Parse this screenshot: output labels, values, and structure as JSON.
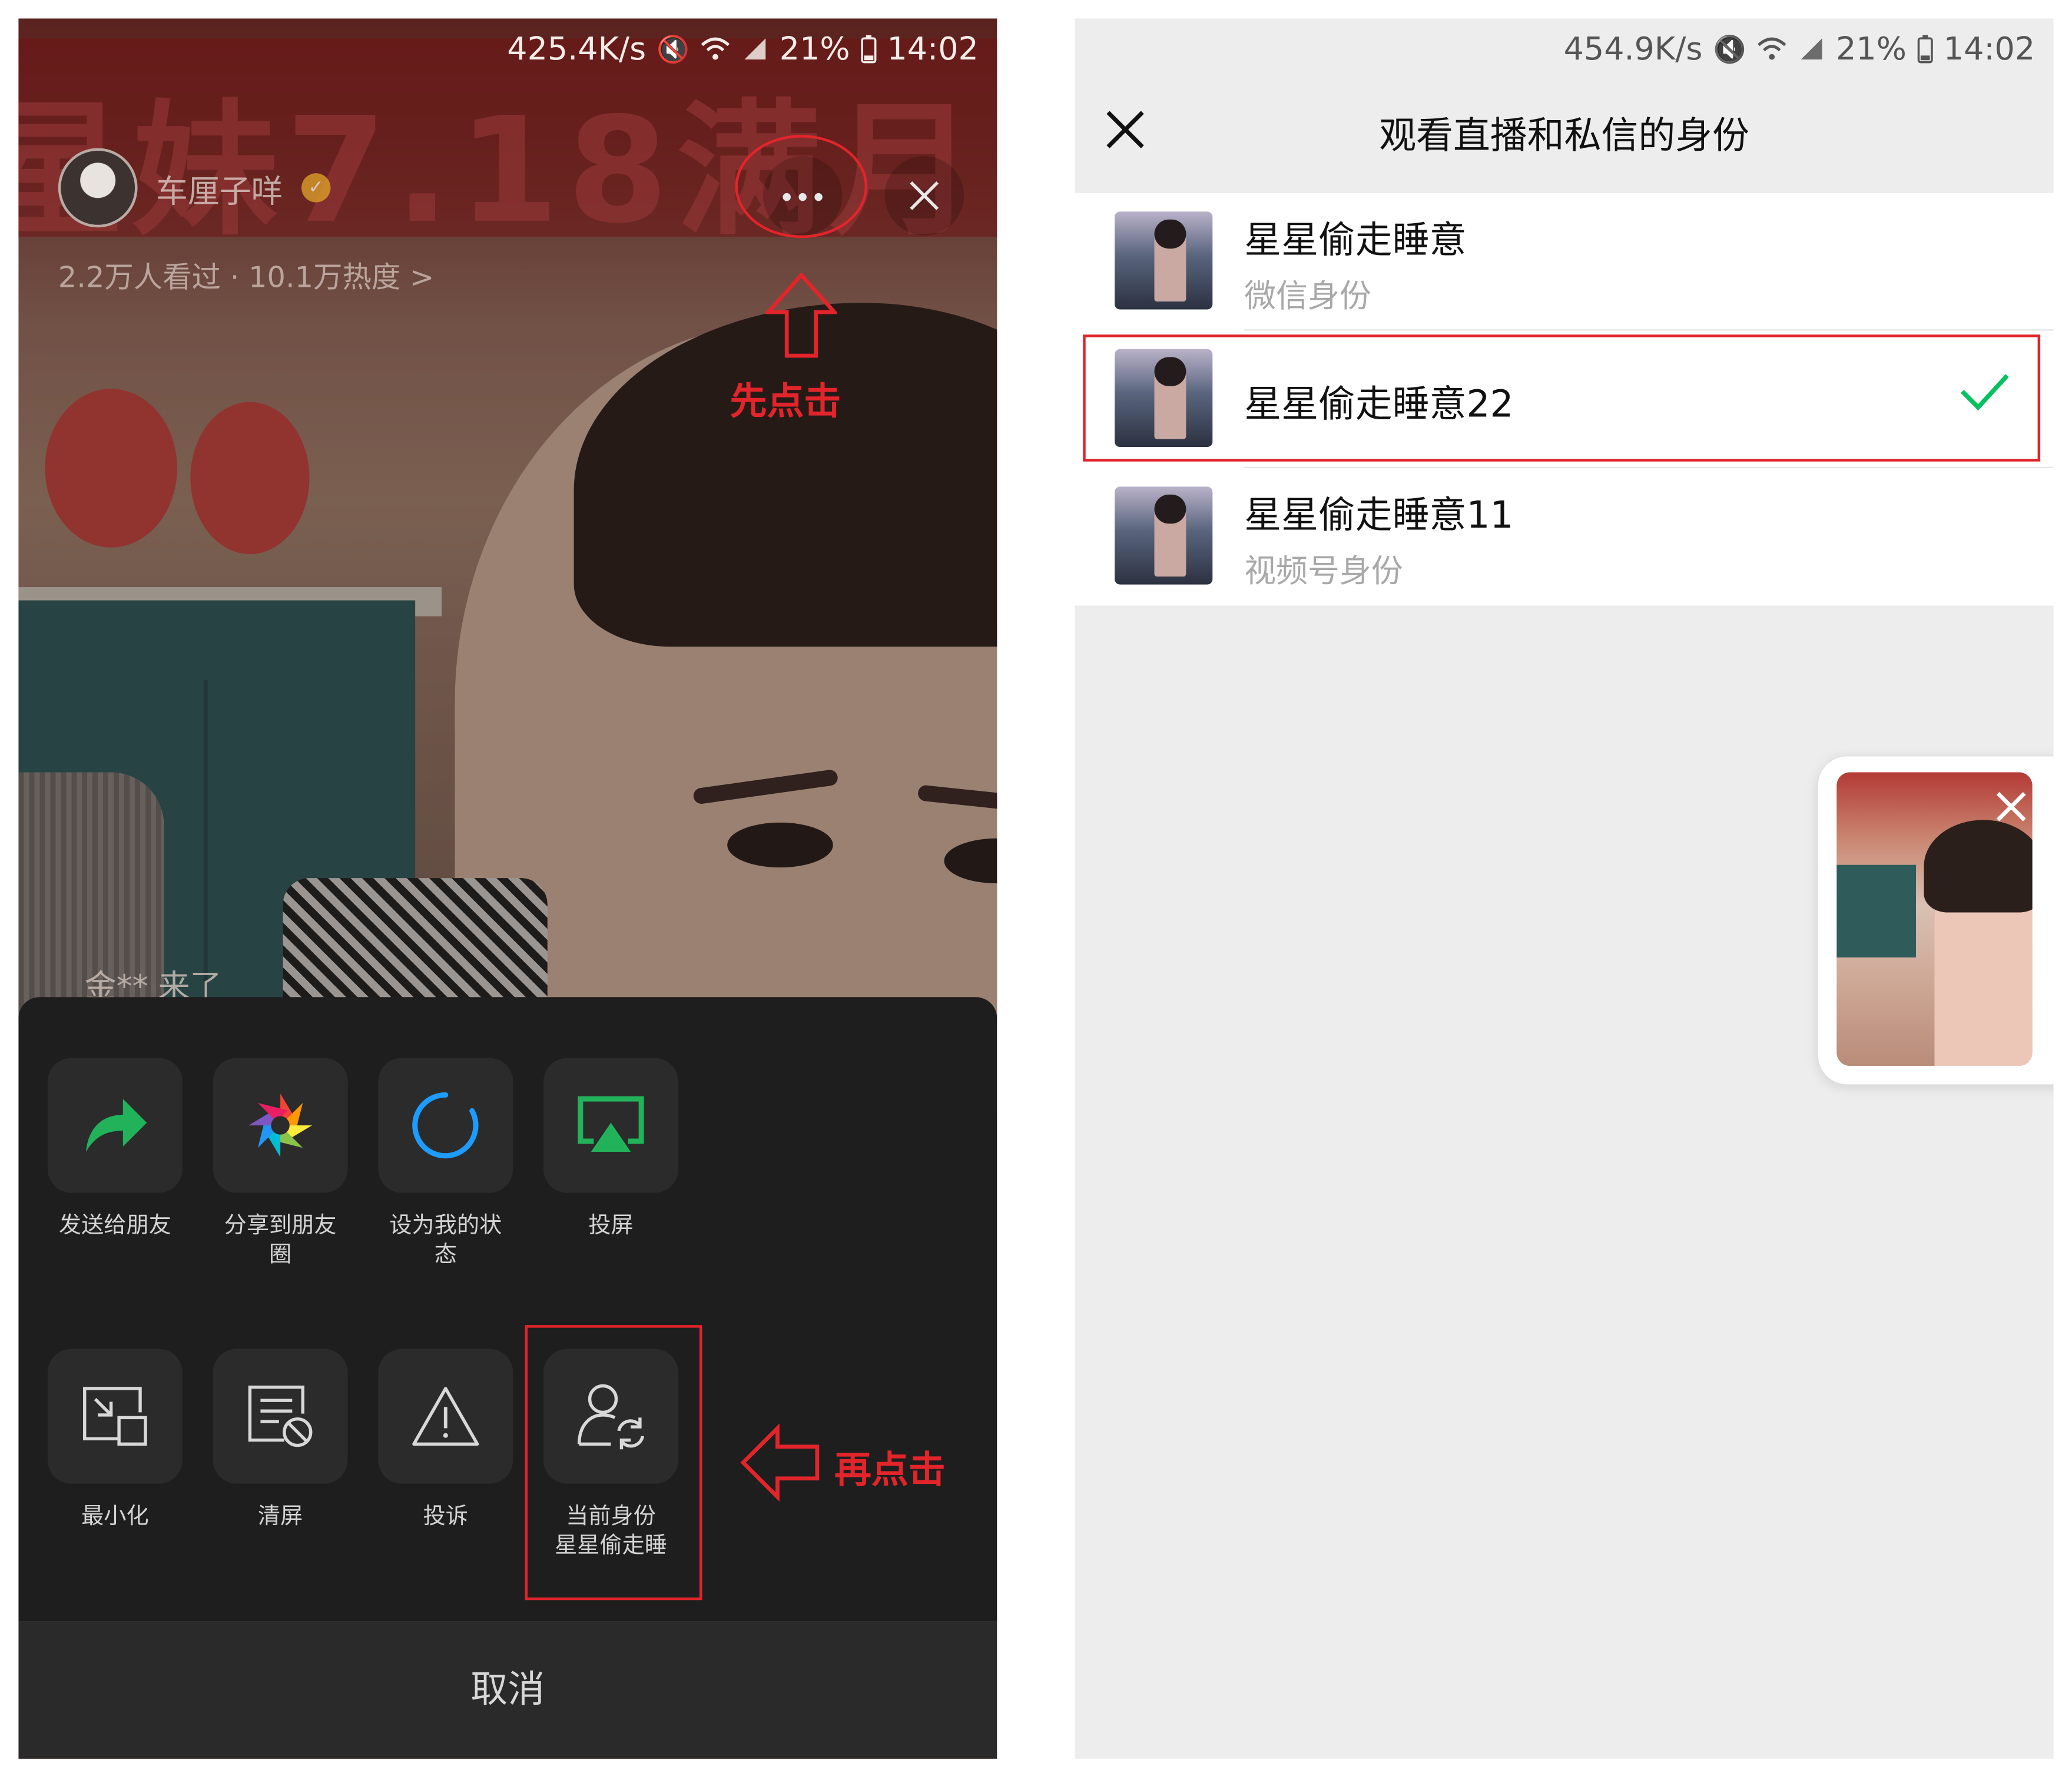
{
  "left": {
    "status_bar": {
      "speed": "425.4K/s",
      "battery": "21%",
      "time": "14:02"
    },
    "live_bg": {
      "banner_text": "星妹7.18满月"
    },
    "anchor": {
      "name": "车厘子咩",
      "stats": "2.2万人看过 · 10.1万热度 >"
    },
    "comment": "金** 来了",
    "annotations": {
      "first_click": "先点击",
      "second_click": "再点击"
    },
    "actions": [
      {
        "label": "发送给朋友",
        "icon": "share-arrow-icon"
      },
      {
        "label": "分享到朋友圈",
        "icon": "moments-shutter-icon"
      },
      {
        "label": "设为我的状态",
        "icon": "status-ring-icon"
      },
      {
        "label": "投屏",
        "icon": "cast-screen-icon"
      },
      {
        "label": "最小化",
        "icon": "minimize-window-icon"
      },
      {
        "label": "清屏",
        "icon": "clear-screen-icon"
      },
      {
        "label": "投诉",
        "icon": "warning-triangle-icon"
      },
      {
        "label": "当前身份\n星星偷走睡",
        "icon": "switch-identity-icon"
      }
    ],
    "cancel_label": "取消"
  },
  "right": {
    "status_bar": {
      "speed": "454.9K/s",
      "battery": "21%",
      "time": "14:02"
    },
    "title": "观看直播和私信的身份",
    "identities": [
      {
        "name": "星星偷走睡意",
        "sub": "微信身份",
        "selected": false
      },
      {
        "name": "星星偷走睡意22",
        "sub": "",
        "selected": true
      },
      {
        "name": "星星偷走睡意11",
        "sub": "视频号身份",
        "selected": false
      }
    ]
  },
  "colors": {
    "accent_green": "#07c160",
    "annotation_red": "#e2242b",
    "sheet_bg": "#1e1e1e"
  }
}
